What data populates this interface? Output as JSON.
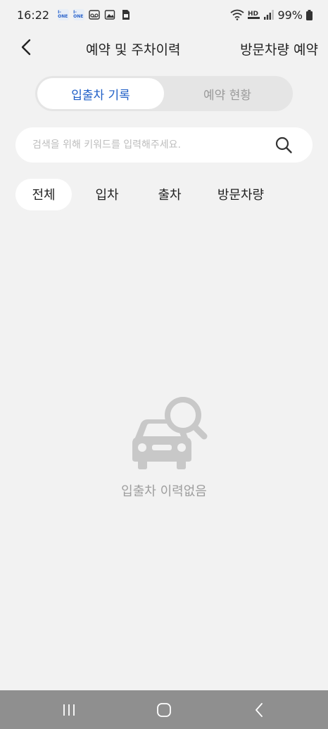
{
  "status_bar": {
    "time": "16:22",
    "battery": "99%",
    "icons": [
      "i-one-app-icon",
      "i-one-app-icon",
      "voicemail-icon",
      "gallery-icon",
      "sim-icon",
      "wifi-icon",
      "hd-voice-icon",
      "signal-icon",
      "battery-icon"
    ],
    "notif_label": "I-ONE"
  },
  "header": {
    "title": "예약 및 주차이력",
    "action": "방문차량 예약"
  },
  "tabs": [
    {
      "label": "입출차 기록",
      "active": true
    },
    {
      "label": "예약 현황",
      "active": false
    }
  ],
  "search": {
    "placeholder": "검색을 위해 키워드를 입력해주세요.",
    "value": ""
  },
  "filters": [
    {
      "label": "전체",
      "active": true
    },
    {
      "label": "입차",
      "active": false
    },
    {
      "label": "출차",
      "active": false
    },
    {
      "label": "방문차량",
      "active": false
    }
  ],
  "empty_state": {
    "message": "입출차 이력없음",
    "icon": "car-search-icon"
  },
  "nav": {
    "buttons": [
      "recents-icon",
      "home-icon",
      "back-icon"
    ]
  },
  "colors": {
    "accent": "#1f5fc7",
    "background": "#f2f2f2",
    "muted": "#9e9e9e",
    "nav_bar": "#8f8f8f"
  }
}
